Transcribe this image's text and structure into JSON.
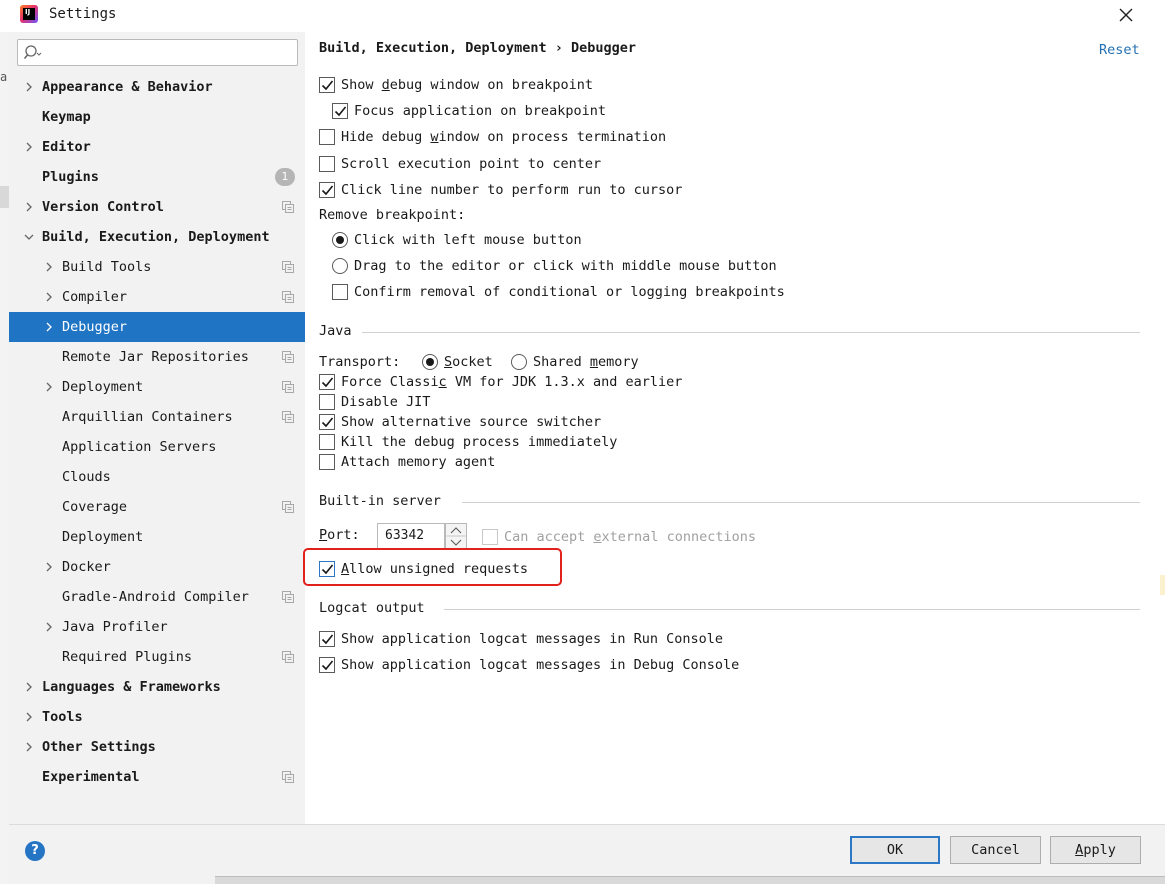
{
  "window": {
    "title": "Settings",
    "close_label": "✕"
  },
  "left_edge_letter": "a",
  "search": {
    "placeholder": "",
    "value": ""
  },
  "sidebar": {
    "items": [
      {
        "label": "Appearance & Behavior",
        "bold": true,
        "level": 0,
        "expandable": true,
        "expanded": false
      },
      {
        "label": "Keymap",
        "bold": true,
        "level": 0,
        "expandable": false
      },
      {
        "label": "Editor",
        "bold": true,
        "level": 0,
        "expandable": true,
        "expanded": false
      },
      {
        "label": "Plugins",
        "bold": true,
        "level": 0,
        "expandable": false,
        "badge": "1"
      },
      {
        "label": "Version Control",
        "bold": true,
        "level": 0,
        "expandable": true,
        "expanded": false,
        "project_icon": true
      },
      {
        "label": "Build, Execution, Deployment",
        "bold": true,
        "level": 0,
        "expandable": true,
        "expanded": true
      },
      {
        "label": "Build Tools",
        "level": 1,
        "expandable": true,
        "project_icon": true
      },
      {
        "label": "Compiler",
        "level": 1,
        "expandable": true,
        "project_icon": true
      },
      {
        "label": "Debugger",
        "level": 1,
        "expandable": true,
        "selected": true
      },
      {
        "label": "Remote Jar Repositories",
        "level": 1,
        "expandable": false,
        "project_icon": true
      },
      {
        "label": "Deployment",
        "level": 1,
        "expandable": true,
        "project_icon": true
      },
      {
        "label": "Arquillian Containers",
        "level": 1,
        "expandable": false,
        "project_icon": true
      },
      {
        "label": "Application Servers",
        "level": 1,
        "expandable": false
      },
      {
        "label": "Clouds",
        "level": 1,
        "expandable": false
      },
      {
        "label": "Coverage",
        "level": 1,
        "expandable": false,
        "project_icon": true
      },
      {
        "label": "Deployment",
        "level": 1,
        "expandable": false
      },
      {
        "label": "Docker",
        "level": 1,
        "expandable": true
      },
      {
        "label": "Gradle-Android Compiler",
        "level": 1,
        "expandable": false,
        "project_icon": true
      },
      {
        "label": "Java Profiler",
        "level": 1,
        "expandable": true
      },
      {
        "label": "Required Plugins",
        "level": 1,
        "expandable": false,
        "project_icon": true
      },
      {
        "label": "Languages & Frameworks",
        "bold": true,
        "level": 0,
        "expandable": true
      },
      {
        "label": "Tools",
        "bold": true,
        "level": 0,
        "expandable": true
      },
      {
        "label": "Other Settings",
        "bold": true,
        "level": 0,
        "expandable": true
      },
      {
        "label": "Experimental",
        "bold": true,
        "level": 0,
        "expandable": false,
        "project_icon": true
      }
    ]
  },
  "content": {
    "breadcrumb": "Build, Execution, Deployment  ›  Debugger",
    "reset_label": "Reset",
    "general": {
      "show_debug_window": {
        "pre": "Show ",
        "mn": "d",
        "post": "ebug window on breakpoint",
        "checked": true
      },
      "focus_application": {
        "label": "Focus application on breakpoint",
        "checked": true
      },
      "hide_debug_window": {
        "pre": "Hide debug ",
        "mn": "w",
        "post": "indow on process termination",
        "checked": false
      },
      "scroll_execution": {
        "label": "Scroll execution point to center",
        "checked": false
      },
      "click_line_number": {
        "label": "Click line number to perform run to cursor",
        "checked": true
      },
      "remove_breakpoint_label": "Remove breakpoint:",
      "remove_left_click": {
        "label": "Click with left mouse button",
        "selected": true
      },
      "remove_drag": {
        "label": "Drag to the editor or click with middle mouse button",
        "selected": false
      },
      "confirm_removal": {
        "label": "Confirm removal of conditional or logging breakpoints",
        "checked": false
      }
    },
    "java": {
      "title": "Java",
      "transport_label": "Transport:",
      "socket": {
        "mn": "S",
        "post": "ocket",
        "selected": true
      },
      "shared_memory": {
        "pre": "Shared ",
        "mn": "m",
        "post": "emory",
        "selected": false
      },
      "force_classic": {
        "pre": "Force Classi",
        "mn": "c",
        "post": " VM for JDK 1.3.x and earlier",
        "checked": true
      },
      "disable_jit": {
        "label": "Disable JIT",
        "checked": false
      },
      "alt_source": {
        "label": "Show alternative source switcher",
        "checked": true
      },
      "kill_process": {
        "label": "Kill the debug process immediately",
        "checked": false
      },
      "memory_agent": {
        "label": "Attach memory agent",
        "checked": false
      }
    },
    "builtin_server": {
      "title": "Built-in server",
      "port_label_mn": "P",
      "port_label_post": "ort:",
      "port_value": "63342",
      "external": {
        "pre": "Can accept ",
        "mn": "e",
        "post": "xternal connections",
        "checked": false
      },
      "allow_unsigned": {
        "mn": "A",
        "post": "llow unsigned requests",
        "checked": true
      }
    },
    "logcat": {
      "title": "Logcat output",
      "run_console": {
        "label": "Show application logcat messages in Run Console",
        "checked": true
      },
      "debug_console": {
        "label": "Show application logcat messages in Debug Console",
        "checked": true
      }
    }
  },
  "footer": {
    "help_label": "?",
    "ok_label": "OK",
    "cancel_label": "Cancel",
    "apply_mn": "A",
    "apply_post": "pply"
  },
  "colors": {
    "accent": "#1f74c4",
    "highlight_box": "#e2201c",
    "link": "#2470b3"
  }
}
